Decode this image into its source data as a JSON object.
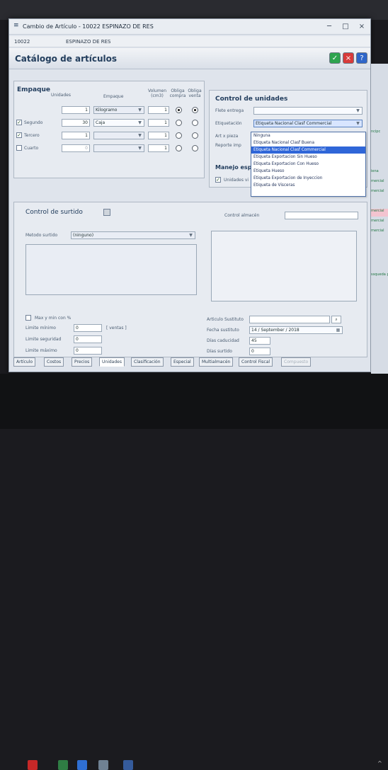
{
  "window": {
    "title": "Cambio de Artículo - 10022 ESPINAZO DE RES",
    "code": "10022",
    "name": "ESPINAZO DE RES",
    "page_title": "Catálogo de artículos"
  },
  "empaque": {
    "title": "Empaque",
    "headers": {
      "unidades": "Unidades",
      "empaque": "Empaque",
      "volumen": "Volumen (cm3)",
      "obliga_compra": "Obliga compra",
      "obliga_venta": "Obliga venta"
    },
    "rows": [
      {
        "label": "",
        "units": "1",
        "package": "Kilogramo",
        "volume": "1"
      },
      {
        "label": "Segundo",
        "units": "30",
        "package": "Caja",
        "volume": "1"
      },
      {
        "label": "Tercero",
        "units": "1",
        "package": "",
        "volume": "1"
      },
      {
        "label": "Cuarto",
        "units": "0",
        "package": "",
        "volume": "1"
      }
    ]
  },
  "control_unidades": {
    "title": "Control de unidades",
    "flete_label": "Flete entrega",
    "etiquetacion_label": "Etiquetación",
    "etiquetacion_value": "Etiqueta Nacional Clasf Commercial",
    "art_pieza_label": "Art x pieza",
    "reporte_label": "Reporte imp",
    "manejo_label": "Manejo esp",
    "unidades_label": "Unidades vi"
  },
  "dropdown_options": [
    "Ninguna",
    "Etiqueta Nacional Clasf Buena",
    "Etiqueta Nacional Clasf Commercial",
    "Etiqueta Exportacion Sin Hueso",
    "Etiqueta Exportacion Con Hueso",
    "Etiqueta Hueso",
    "Etiqueta Exportacion de Inyeccion",
    "Etiqueta de Visceras"
  ],
  "surtido": {
    "title": "Control de surtido",
    "metodo_label": "Metodo surtido",
    "metodo_value": "(ninguno)",
    "control_almacen_label": "Control almacén",
    "max_min_label": "Max y min con %",
    "limite_minimo_label": "Limite mínimo",
    "limite_minimo_value": "0",
    "ventas_label": "[ ventas ]",
    "limite_seguridad_label": "Limite seguridad",
    "limite_seguridad_value": "0",
    "limite_maximo_label": "Limite máximo",
    "limite_maximo_value": "0",
    "articulo_sustituto_label": "Articulo Sustituto",
    "fecha_sustituto_label": "Fecha sustituto",
    "fecha_sustituto_value": "14 / September / 2018",
    "dias_caducidad_label": "Días caducidad",
    "dias_caducidad_value": "45",
    "dias_surtido_label": "Días surtido",
    "dias_surtido_value": "0"
  },
  "tabs": [
    "Artículo",
    "Costos",
    "Precios",
    "Unidades",
    "Clasificación",
    "Especial",
    "Multialmacén",
    "Control Fiscal",
    "Compuesto"
  ],
  "background_right": [
    "ncipc",
    "iena",
    "mercial",
    "mercial",
    "mercial",
    "mercial",
    "mercial",
    "ssqueda p"
  ]
}
